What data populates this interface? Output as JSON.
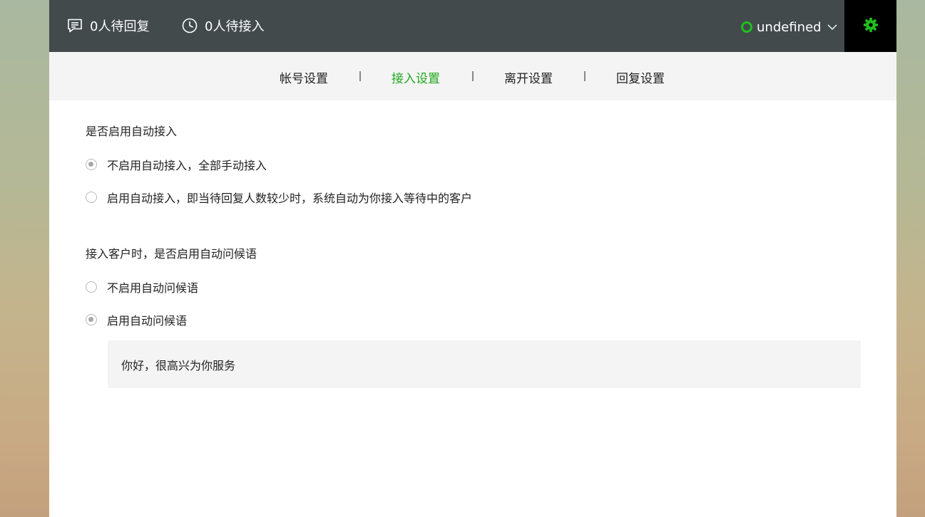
{
  "header": {
    "pending_reply": "0人待回复",
    "pending_access": "0人待接入",
    "username": "undefined",
    "icons": {
      "pending_reply": "chat-message-icon",
      "pending_access": "clock-icon",
      "status": "online-status-icon",
      "dropdown": "chevron-down-icon",
      "settings": "gear-icon"
    },
    "status_color": "#1fbf1f"
  },
  "tabs": [
    {
      "label": "帐号设置",
      "active": false
    },
    {
      "label": "接入设置",
      "active": true
    },
    {
      "label": "离开设置",
      "active": false
    },
    {
      "label": "回复设置",
      "active": false
    }
  ],
  "sections": {
    "auto_access": {
      "title": "是否启用自动接入",
      "options": [
        {
          "label": "不启用自动接入，全部手动接入",
          "checked": true
        },
        {
          "label": "启用自动接入，即当待回复人数较少时，系统自动为你接入等待中的客户",
          "checked": false
        }
      ]
    },
    "auto_greeting": {
      "title": "接入客户时，是否启用自动问候语",
      "options": [
        {
          "label": "不启用自动问候语",
          "checked": false
        },
        {
          "label": "启用自动问候语",
          "checked": true
        }
      ],
      "greeting_text": "你好，很高兴为你服务"
    }
  },
  "colors": {
    "accent": "#1fa81f",
    "topbar": "#424a4c",
    "subnav": "#f4f4f4"
  }
}
